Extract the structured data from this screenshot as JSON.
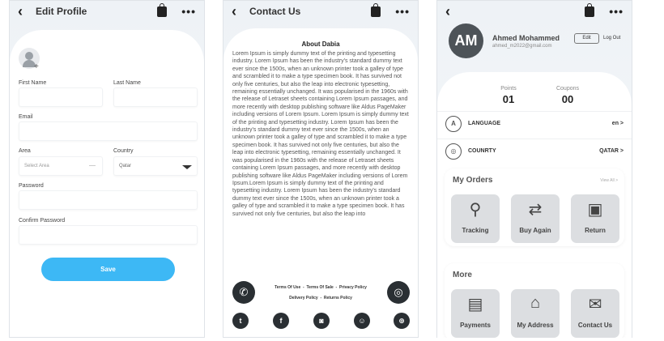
{
  "edit_profile": {
    "title": "Edit Profile",
    "first_name_label": "First Name",
    "last_name_label": "Last Name",
    "email_label": "Email",
    "area_label": "Area",
    "area_placeholder": "Select Area",
    "country_label": "Country",
    "country_value": "Qatar",
    "password_label": "Password",
    "confirm_password_label": "Confirm Password",
    "save_label": "Save"
  },
  "contact_us": {
    "title": "Contact Us",
    "about_title": "About Dabia",
    "about_text": "Lorem Ipsum is simply dummy text of the printing and typesetting industry. Lorem Ipsum has been the industry's standard dummy text ever since the 1500s, when an unknown printer took a galley of type and scrambled it to make a type specimen book. It has survived not only five centuries, but also the leap into electronic typesetting, remaining essentially unchanged. It was popularised in the 1960s with the release of Letraset sheets containing Lorem Ipsum passages, and more recently with desktop publishing software like Aldus PageMaker including versions of Lorem Ipsum. Lorem Ipsum is simply dummy text of the printing and typesetting industry. Lorem Ipsum has been the industry's standard dummy text ever since the 1500s, when an unknown printer took a galley of type and scrambled it to make a type specimen book. It has survived not only five centuries, but also the leap into electronic typesetting, remaining essentially unchanged. It was popularised in the 1960s with the release of Letraset sheets containing Lorem Ipsum passages, and more recently with desktop publishing software like Aldus PageMaker including versions of Lorem Ipsum.Lorem Ipsum is simply dummy text of the printing and typesetting industry. Lorem Ipsum has been the industry's standard dummy text ever since the 1500s, when an unknown printer took a galley of type and scrambled it to make a type specimen book. It has survived not only five centuries, but also the leap into",
    "terms_of_use": "Terms Of Use",
    "terms_of_sale": "Terms Of Sale",
    "privacy_policy": "Privacy Policy",
    "delivery_policy": "Delivery Policy",
    "returns_policy": "Returns Policy",
    "separator": "-"
  },
  "profile": {
    "initials": "AM",
    "name": "Ahmed Mohammed",
    "email": "ahmed_m2022@gmail.com",
    "edit_label": "Edit",
    "logout_label": "Log Out",
    "points_label": "Points",
    "points_value": "01",
    "coupons_label": "Coupons",
    "coupons_value": "00",
    "language_label": "LANGUAGE",
    "language_value": "en >",
    "country_label": "COUNRTY",
    "country_value": "QATAR >",
    "orders_title": "My Orders",
    "view_all": "View All >",
    "tracking": "Tracking",
    "buy_again": "Buy Again",
    "return": "Return",
    "more_title": "More",
    "payments": "Payments",
    "my_address": "My Address",
    "contact_us": "Contact Us"
  },
  "icons": {
    "back": "back-chevron-icon",
    "bag": "shopping-bag-icon",
    "more": "more-dots-icon",
    "accent": "#3db8f5",
    "dark": "#2a2f33"
  }
}
